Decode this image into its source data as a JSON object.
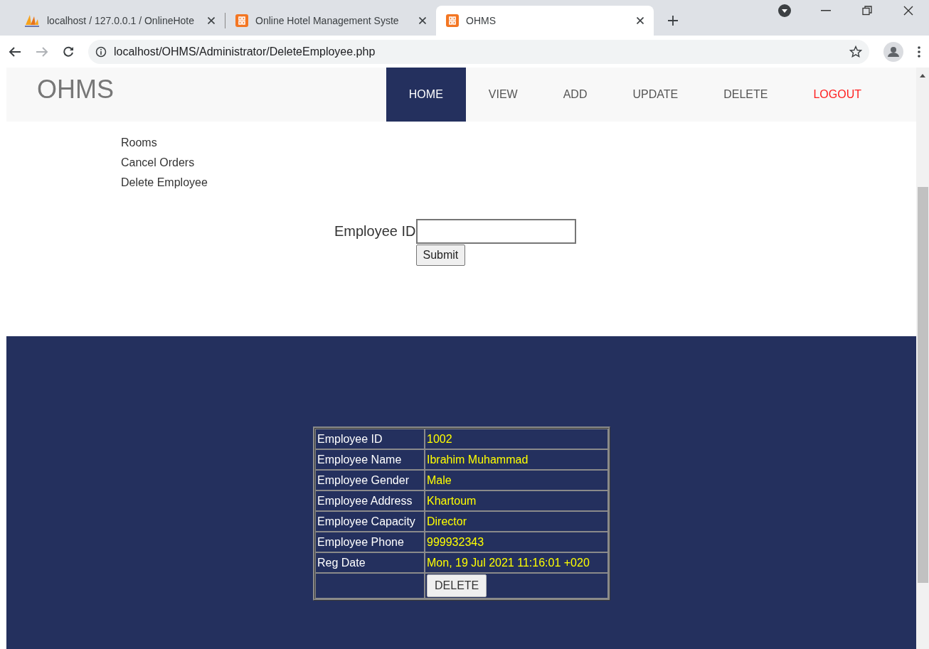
{
  "browser": {
    "tabs": [
      {
        "title": "localhost / 127.0.0.1 / OnlineHote",
        "selected": false
      },
      {
        "title": "Online Hotel Management Syste",
        "selected": false
      },
      {
        "title": "OHMS",
        "selected": true
      }
    ],
    "url": "localhost/OHMS/Administrator/DeleteEmployee.php"
  },
  "site": {
    "logo": "OHMS",
    "nav": [
      {
        "label": "HOME",
        "selected": true,
        "kind": "link"
      },
      {
        "label": "VIEW",
        "selected": false,
        "kind": "link"
      },
      {
        "label": "ADD",
        "selected": false,
        "kind": "link"
      },
      {
        "label": "UPDATE",
        "selected": false,
        "kind": "link"
      },
      {
        "label": "DELETE",
        "selected": false,
        "kind": "link"
      },
      {
        "label": "LOGOUT",
        "selected": false,
        "kind": "logout"
      }
    ]
  },
  "side_links": [
    "Rooms",
    "Cancel Orders",
    "Delete Employee"
  ],
  "form": {
    "label": "Employee ID",
    "button": "Submit"
  },
  "employee_table": {
    "rows": [
      {
        "label": "Employee ID",
        "value": "1002"
      },
      {
        "label": "Employee Name",
        "value": "Ibrahim Muhammad"
      },
      {
        "label": "Employee Gender",
        "value": "Male"
      },
      {
        "label": "Employee Address",
        "value": "Khartoum"
      },
      {
        "label": "Employee Capacity",
        "value": "Director"
      },
      {
        "label": "Employee Phone",
        "value": "999932343"
      },
      {
        "label": "Reg Date",
        "value": "Mon, 19 Jul 2021 11:16:01 +020"
      }
    ],
    "button": "DELETE"
  }
}
